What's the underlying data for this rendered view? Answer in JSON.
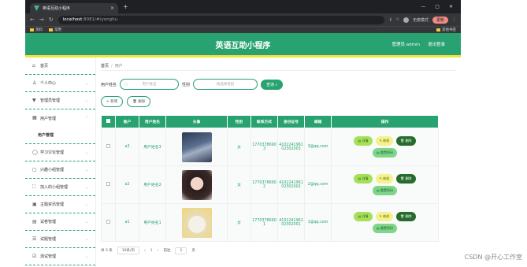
{
  "browser": {
    "tab_title": "英语互助小程序",
    "url_host": "localhost",
    "url_path": ":8081/#/yonghu",
    "mode_label": "无痕模式",
    "update_label": "更新",
    "bookmarks": [
      "资料",
      "常用"
    ],
    "bookmarks_right": "其他书签"
  },
  "header": {
    "title": "英语互助小程序",
    "user_label": "管理员 admin",
    "logout": "退出登录"
  },
  "sidebar": {
    "home": "首页",
    "items": [
      {
        "label": "个人中心",
        "icon": "user-icon"
      },
      {
        "label": "管理员管理",
        "icon": "admin-icon"
      },
      {
        "label": "用户管理",
        "icon": "grid-icon"
      },
      {
        "label": "学习讨论管理",
        "icon": "chat-icon"
      },
      {
        "label": "兴趣小组管理",
        "icon": "group-icon"
      },
      {
        "label": "加入的小组管理",
        "icon": "join-icon"
      },
      {
        "label": "主题资讯管理",
        "icon": "news-icon"
      },
      {
        "label": "试卷管理",
        "icon": "paper-icon"
      },
      {
        "label": "试题管理",
        "icon": "question-icon"
      },
      {
        "label": "测试管理",
        "icon": "test-icon"
      }
    ],
    "subitem": "用户管理"
  },
  "main": {
    "breadcrumb_home": "首页",
    "breadcrumb_current": "用户",
    "search": {
      "name_label": "用户姓名",
      "name_placeholder": "用户姓名",
      "gender_label": "性别",
      "gender_placeholder": "请选择性别",
      "query_button": "查询"
    },
    "add_button": "+ 新增",
    "delete_button": "删除",
    "table": {
      "headers": [
        "账户",
        "用户姓名",
        "头像",
        "性别",
        "联系方式",
        "身份证号",
        "邮箱",
        "操作"
      ],
      "rows": [
        {
          "account": "a3",
          "name": "用户姓名3",
          "gender": "女",
          "phone": "17703786903",
          "idcard": "410224196102302003",
          "email": "3@qq.com"
        },
        {
          "account": "a2",
          "name": "用户姓名2",
          "gender": "女",
          "phone": "17703786902",
          "idcard": "410224196102302002",
          "email": "2@qq.com"
        },
        {
          "account": "a1",
          "name": "用户姓名1",
          "gender": "女",
          "phone": "17703786901",
          "idcard": "410224196102302001",
          "email": "1@qq.com"
        }
      ],
      "op_detail": "详情",
      "op_edit": "修改",
      "op_delete": "删除",
      "op_reset": "重置密码"
    },
    "pager": {
      "total": "共 3 条",
      "page_size": "10条/页",
      "current_page": "1",
      "goto_label": "前往",
      "goto_value": "1",
      "page_suffix": "页"
    }
  },
  "watermark": "CSDN @开心工作室"
}
